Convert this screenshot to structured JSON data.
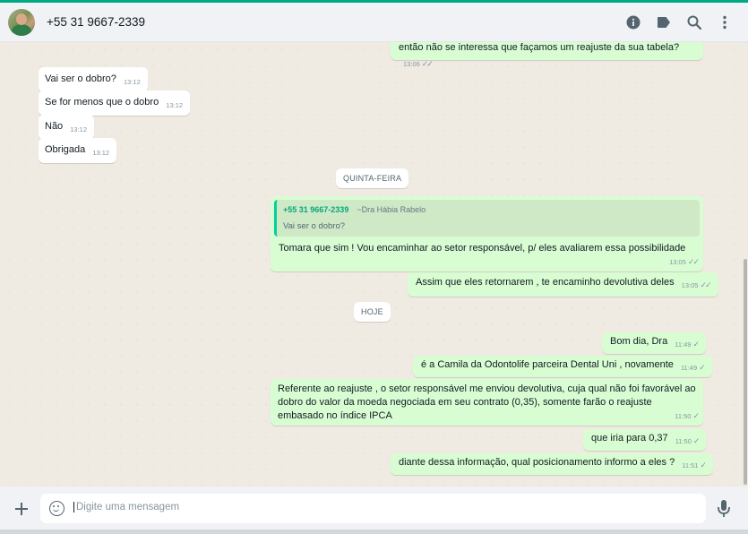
{
  "header": {
    "contact_name": "+55 31 9667-2339",
    "icons": [
      "info-icon",
      "label-icon",
      "search-icon",
      "menu-icon"
    ]
  },
  "messages": {
    "m0": {
      "text": "então não se interessa que façamos um reajuste da sua tabela?",
      "time": "13:06",
      "status": "read"
    },
    "m1": {
      "text": "Vai ser o dobro?",
      "time": "13:12"
    },
    "m2": {
      "text": "Se for menos que o dobro",
      "time": "13:12"
    },
    "m3": {
      "text": "Não",
      "time": "13:12"
    },
    "m4": {
      "text": "Obrigada",
      "time": "13:12"
    },
    "day1": "QUINTA-FEIRA",
    "m5": {
      "quote_author": "+55 31 9667-2339",
      "quote_pushname": "~Dra Hábia Rabelo",
      "quote_text": "Vai ser o dobro?",
      "text": "Tomara que sim ! Vou encaminhar ao setor responsável, p/ eles avaliarem essa possibilidade",
      "time": "13:05",
      "status": "read"
    },
    "m6": {
      "text": "Assim que eles retornarem , te encaminho devolutiva deles",
      "time": "13:05",
      "status": "read"
    },
    "day2": "HOJE",
    "m7": {
      "text": "Bom dia, Dra",
      "time": "11:49",
      "status": "sent"
    },
    "m8": {
      "text": "é a Camila da Odontolife parceira Dental Uni , novamente",
      "time": "11:49",
      "status": "sent"
    },
    "m9": {
      "text": "Referente ao reajuste , o setor responsável me enviou devolutiva, cuja qual não foi favorável ao dobro do valor da moeda negociada em seu contrato (0,35), somente farão o reajuste embasado no índice IPCA",
      "time": "11:50",
      "status": "sent"
    },
    "m10": {
      "text": "que iria para 0,37",
      "time": "11:50",
      "status": "sent"
    },
    "m11": {
      "text": "diante dessa informação, qual posicionamento informo a eles ?",
      "time": "11:51",
      "status": "sent"
    }
  },
  "composer": {
    "placeholder": "Digite uma mensagem",
    "icons": [
      "plus-icon",
      "emoji-icon",
      "mic-icon"
    ]
  },
  "colors": {
    "accent": "#00a884",
    "outgoing_bubble": "#d9fdd3",
    "incoming_bubble": "#ffffff",
    "chat_background": "#efeae2",
    "quote_author": "#06a77d"
  }
}
